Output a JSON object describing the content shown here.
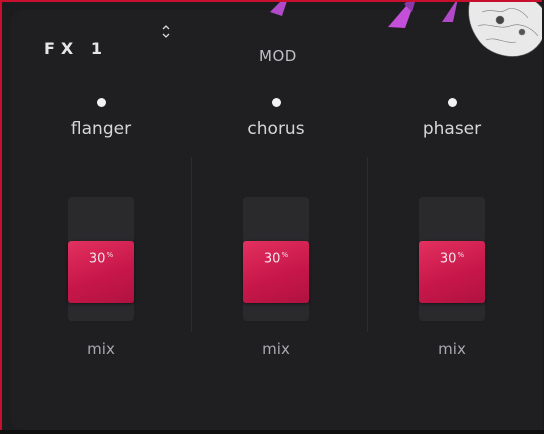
{
  "header": {
    "title": "FX 1",
    "section": "MOD"
  },
  "effects": [
    {
      "name": "flanger",
      "mix_label": "mix",
      "mix_value": "30",
      "mix_unit": "%"
    },
    {
      "name": "chorus",
      "mix_label": "mix",
      "mix_value": "30",
      "mix_unit": "%"
    },
    {
      "name": "phaser",
      "mix_label": "mix",
      "mix_value": "30",
      "mix_unit": "%"
    }
  ],
  "colors": {
    "accent": "#d81b52",
    "frame": "#c8102e",
    "background": "#1f1f21"
  },
  "icons": {
    "selector": "up-down-chevron-icon",
    "indicator": "led-dot-icon"
  }
}
